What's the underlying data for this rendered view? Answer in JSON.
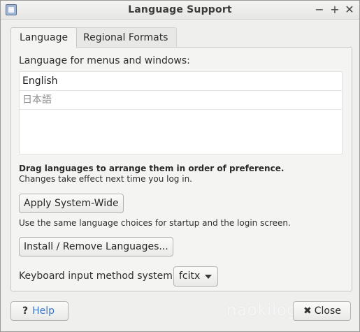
{
  "window": {
    "title": "Language Support",
    "controls": {
      "minimize": "−",
      "maximize": "+",
      "close": "✕"
    }
  },
  "tabs": [
    {
      "label": "Language",
      "active": true
    },
    {
      "label": "Regional Formats",
      "active": false
    }
  ],
  "language_tab": {
    "menus_label": "Language for menus and windows:",
    "languages": [
      "English",
      "日本語"
    ],
    "drag_hint": "Drag languages to arrange them in order of preference.",
    "effect_hint": "Changes take effect next time you log in.",
    "apply_button": "Apply System-Wide",
    "apply_hint": "Use the same language choices for startup and the login screen.",
    "install_button": "Install / Remove Languages...",
    "keyboard_label": "Keyboard input method system:",
    "keyboard_value": "fcitx"
  },
  "footer": {
    "help_icon": "?",
    "help_label": "Help",
    "close_icon": "✖",
    "close_label": "Close"
  },
  "watermark": "naokilog.com",
  "icons": {
    "app": "language-support-app-icon",
    "help": "question-icon",
    "close": "close-x-icon",
    "dropdown": "dropdown-caret-icon"
  },
  "colors": {
    "help_text": "#3a77c9",
    "window_bg": "#efefee"
  }
}
